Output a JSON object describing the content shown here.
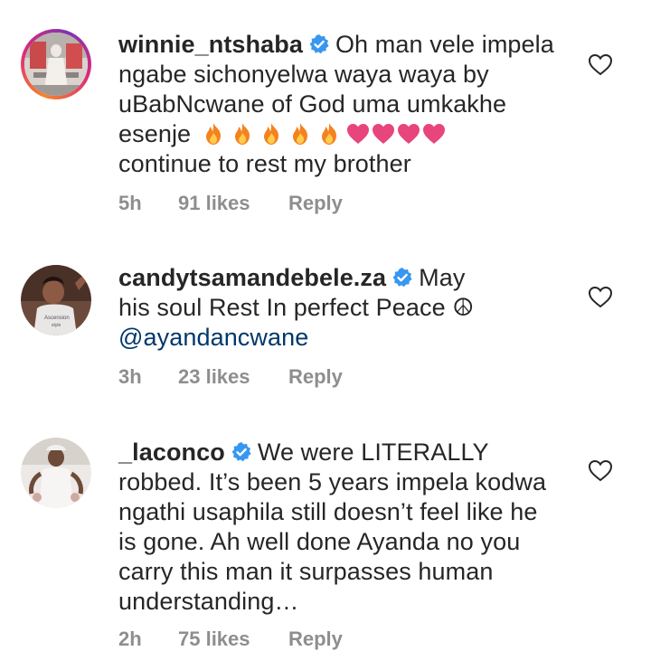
{
  "comments": [
    {
      "username": "winnie_ntshaba",
      "text_lines": [
        "Oh man vele impela",
        "ngabe sichonyelwa waya waya by",
        "uBabNcwane of God uma umkakhe",
        "esenje"
      ],
      "emojis": [
        "fire",
        "fire",
        "fire",
        "fire",
        "fire",
        "heart",
        "heart",
        "heart",
        "heart"
      ],
      "text_after": "continue to rest my brother",
      "time": "5h",
      "likes": "91 likes",
      "reply_label": "Reply"
    },
    {
      "username": "candytsamandebele.za",
      "text_lines": [
        "May",
        "his soul Rest In perfect Peace ☮"
      ],
      "mention": "@ayandancwane",
      "time": "3h",
      "likes": "23 likes",
      "reply_label": "Reply"
    },
    {
      "username": "_laconco",
      "text_lines": [
        "We were LITERALLY",
        "robbed. It’s been 5 years impela kodwa",
        "ngathi usaphila still doesn’t feel like he",
        "is gone. Ah well done Ayanda no you",
        "carry this man it surpasses human",
        "understanding…"
      ],
      "time": "2h",
      "likes": "75 likes",
      "reply_label": "Reply"
    }
  ],
  "colors": {
    "text": "#262626",
    "secondary": "#8e8e8e",
    "verified": "#3897f0",
    "mention": "#00376b",
    "fire": "#f5821f",
    "heart": "#e8457c"
  }
}
